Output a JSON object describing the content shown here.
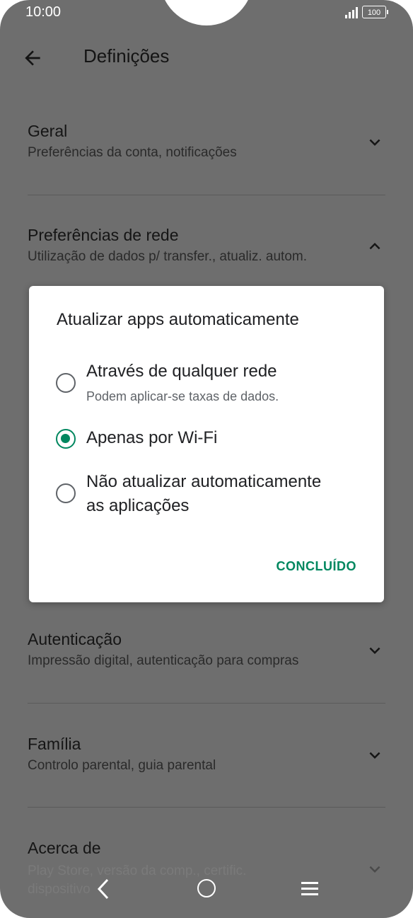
{
  "status": {
    "time": "10:00",
    "battery": "100"
  },
  "appbar": {
    "title": "Definições",
    "back_icon": "arrow-left-icon"
  },
  "settings": [
    {
      "title": "Geral",
      "subtitle": "Preferências da conta, notificações",
      "chevron": "chevron-down-icon"
    },
    {
      "title": "Preferências de rede",
      "subtitle": "Utilização de dados p/ transfer., atualiz. autom.",
      "chevron": "chevron-up-icon"
    },
    {
      "title": "Autenticação",
      "subtitle": "Impressão digital, autenticação para compras",
      "chevron": "chevron-down-icon"
    },
    {
      "title": "Família",
      "subtitle": "Controlo parental, guia parental",
      "chevron": "chevron-down-icon"
    },
    {
      "title": "Acerca de",
      "subtitle": "Play Store, versão da comp., certific. dispositivo",
      "chevron": "chevron-down-icon"
    }
  ],
  "dialog": {
    "title": "Atualizar apps automaticamente",
    "options": [
      {
        "label": "Através de qualquer rede",
        "sublabel": "Podem aplicar-se taxas de dados.",
        "selected": false
      },
      {
        "label": "Apenas por Wi-Fi",
        "selected": true
      },
      {
        "label_line1": "Não atualizar automaticamente",
        "label_line2": "as aplicações",
        "selected": false
      }
    ],
    "done_label": "CONCLUÍDO",
    "accent_color": "#01875f"
  },
  "navbar": {
    "back_icon": "nav-back-icon",
    "home_icon": "nav-home-icon",
    "menu_icon": "nav-menu-icon"
  }
}
